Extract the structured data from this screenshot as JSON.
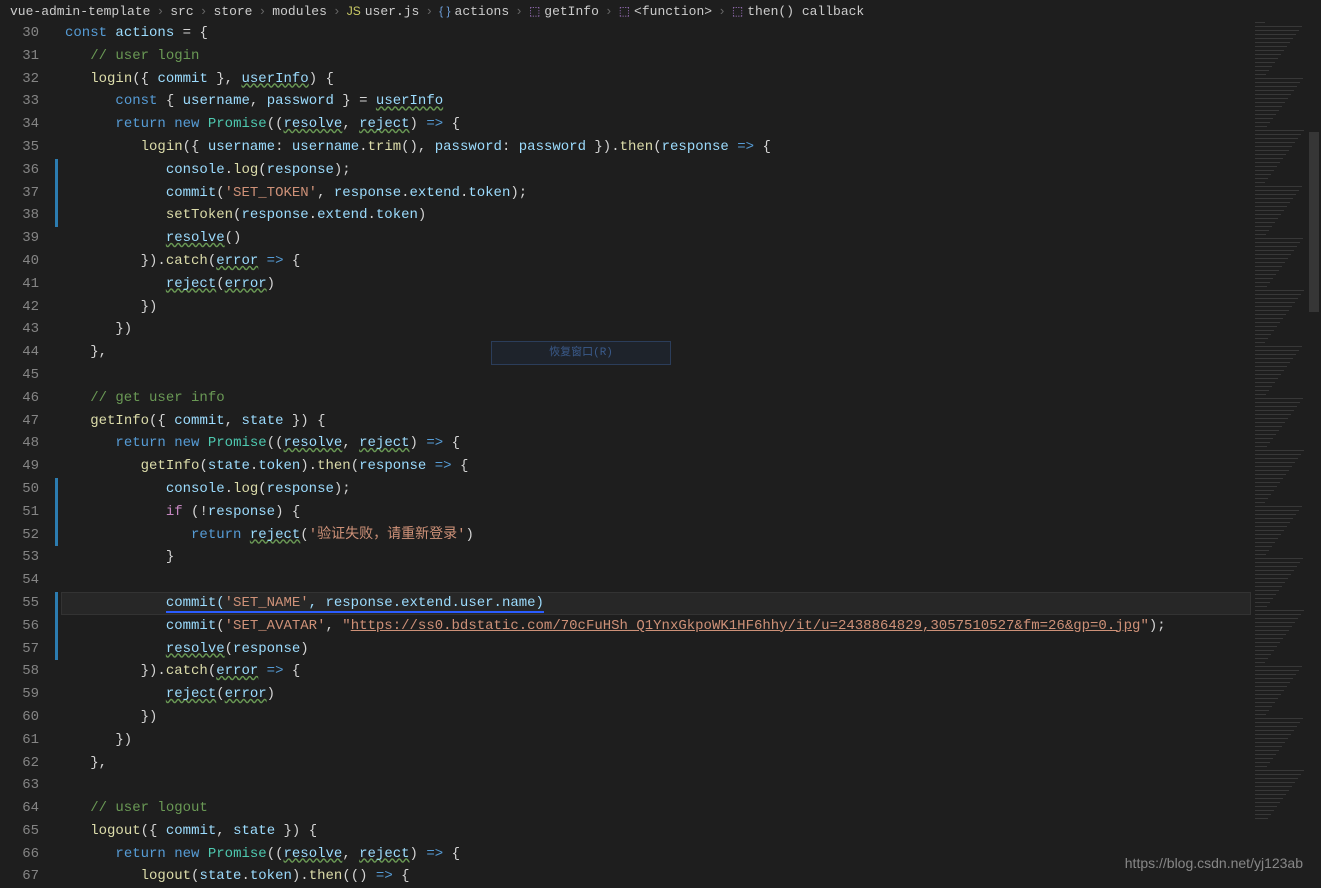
{
  "breadcrumbs": [
    {
      "label": "vue-admin-template",
      "icon": ""
    },
    {
      "label": "src",
      "icon": ""
    },
    {
      "label": "store",
      "icon": ""
    },
    {
      "label": "modules",
      "icon": ""
    },
    {
      "label": "user.js",
      "icon": "js"
    },
    {
      "label": "actions",
      "icon": "field"
    },
    {
      "label": "getInfo",
      "icon": "method"
    },
    {
      "label": "<function>",
      "icon": "method"
    },
    {
      "label": "then() callback",
      "icon": "method"
    }
  ],
  "ghost_button": "恢复窗口(R)",
  "watermark": "https://blog.csdn.net/yj123ab",
  "line_start": 30,
  "line_end": 67,
  "highlighted_line": 55,
  "ribbons": [
    {
      "from": 36,
      "to": 38
    },
    {
      "from": 50,
      "to": 52
    },
    {
      "from": 55,
      "to": 57
    }
  ],
  "code_lines": [
    "const actions = {",
    "  // user login",
    "  login({ commit }, userInfo) {",
    "    const { username, password } = userInfo",
    "    return new Promise((resolve, reject) => {",
    "      login({ username: username.trim(), password: password }).then(response => {",
    "        console.log(response);",
    "        commit('SET_TOKEN', response.extend.token);",
    "        setToken(response.extend.token)",
    "        resolve()",
    "      }).catch(error => {",
    "        reject(error)",
    "      })",
    "    })",
    "  },",
    "",
    "  // get user info",
    "  getInfo({ commit, state }) {",
    "    return new Promise((resolve, reject) => {",
    "      getInfo(state.token).then(response => {",
    "        console.log(response);",
    "        if (!response) {",
    "          return reject('验证失败，请重新登录')",
    "        }",
    "",
    "        commit('SET_NAME', response.extend.user.name)",
    "        commit('SET_AVATAR', \"https://ss0.bdstatic.com/70cFuHSh_Q1YnxGkpoWK1HF6hhy/it/u=2438864829,3057510527&fm=26&gp=0.jpg\");",
    "        resolve(response)",
    "      }).catch(error => {",
    "        reject(error)",
    "      })",
    "    })",
    "  },",
    "",
    "  // user logout",
    "  logout({ commit, state }) {",
    "    return new Promise((resolve, reject) => {",
    "      logout(state.token).then(() => {"
  ]
}
